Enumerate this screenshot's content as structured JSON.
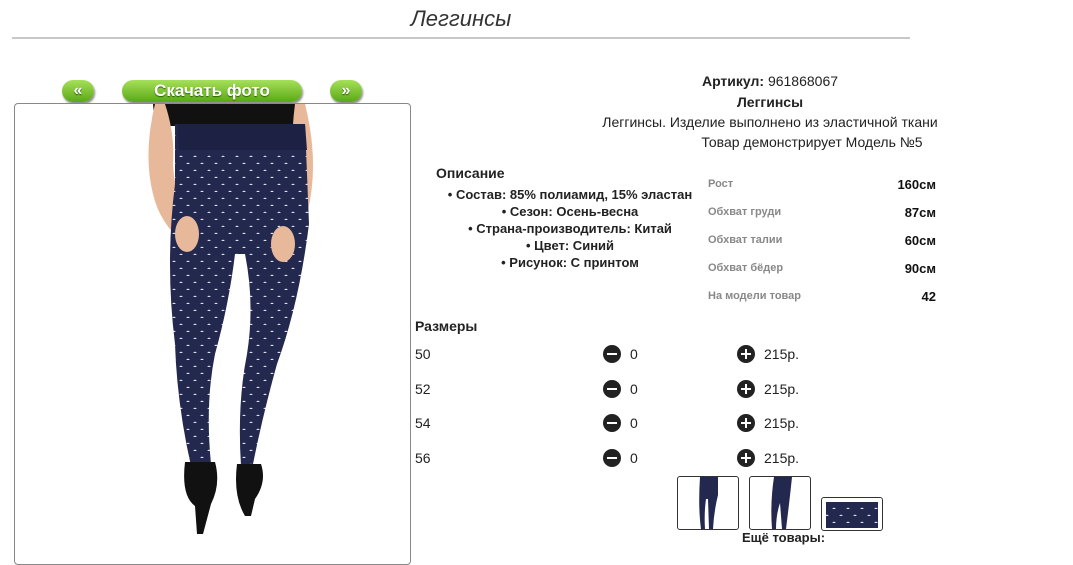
{
  "page": {
    "title": "Леггинсы"
  },
  "gallery": {
    "prev_label": "«",
    "download_label": "Скачать фото",
    "next_label": "»"
  },
  "product": {
    "article_label": "Артикул:",
    "article_value": "961868067",
    "name": "Леггинсы",
    "short_desc": "Леггинсы. Изделие выполнено из эластичной ткани",
    "model_note": "Товар демонстрирует Модель №5"
  },
  "description": {
    "heading": "Описание",
    "items": [
      "Состав: 85% полиамид, 15% эластан",
      "Сезон: Осень-весна",
      "Страна-производитель: Китай",
      "Цвет: Синий",
      "Рисунок: С принтом"
    ]
  },
  "model_params": [
    {
      "label": "Рост",
      "value": "160см"
    },
    {
      "label": "Обхват груди",
      "value": "87см"
    },
    {
      "label": "Обхват талии",
      "value": "60см"
    },
    {
      "label": "Обхват бёдер",
      "value": "90см"
    },
    {
      "label": "На модели товар",
      "value": "42"
    }
  ],
  "sizes": {
    "heading": "Размеры",
    "rows": [
      {
        "size": "50",
        "qty": "0",
        "price": "215р."
      },
      {
        "size": "52",
        "qty": "0",
        "price": "215р."
      },
      {
        "size": "54",
        "qty": "0",
        "price": "215р."
      },
      {
        "size": "56",
        "qty": "0",
        "price": "215р."
      }
    ]
  },
  "more_products": "Ещё товары:",
  "colors": {
    "legging": "#23284f",
    "accent_green": "#5aa815"
  }
}
